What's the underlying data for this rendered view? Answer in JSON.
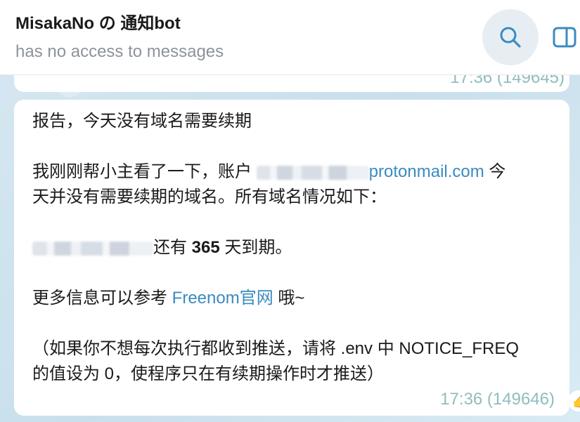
{
  "header": {
    "title": "MisakaNo の 通知bot",
    "status": "has no access to messages"
  },
  "icons": {
    "search": "search-icon",
    "sidebar": "sidebar-toggle-icon"
  },
  "colors": {
    "accent": "#3a8bc0",
    "timestamp": "#8fbdbb",
    "background": "#cfe3ef"
  },
  "previous_message": {
    "time": "17:36 (149645)"
  },
  "message": {
    "line1": "报告，今天没有域名需要续期",
    "line2_prefix": "我刚刚帮小主看了一下，账户 ",
    "line2_link": "protonmail.com",
    "line2_suffix": " 今",
    "line3": "天并没有需要续期的域名。所有域名情况如下：",
    "line4_text": "还有 ",
    "line4_days": "365",
    "line4_suffix": " 天到期。",
    "line5_prefix": "更多信息可以参考 ",
    "line5_link": "Freenom官网",
    "line5_suffix": " 哦~",
    "line6": "（如果你不想每次执行都收到推送，请将 .env 中 NOTICE_FREQ",
    "line7": "的值设为 0，使程序只在有续期操作时才推送）",
    "time": "17:36 (149646)"
  }
}
